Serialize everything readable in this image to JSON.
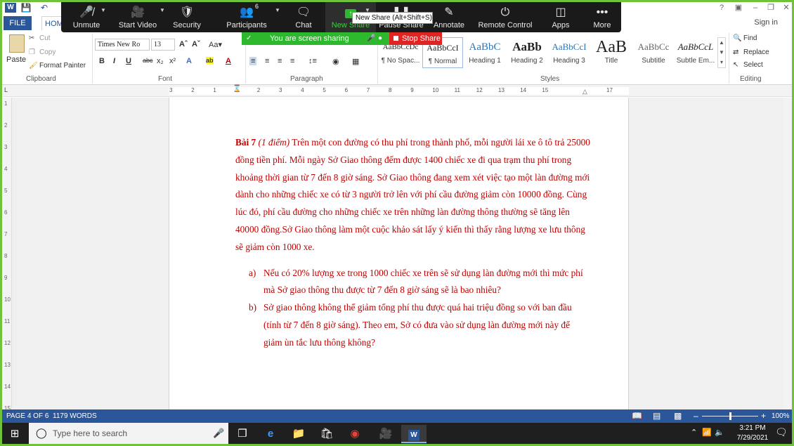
{
  "zoom_toolbar": {
    "unmute": "Unmute",
    "start_video": "Start Video",
    "security": "Security",
    "participants": "Participants",
    "participants_count": "6",
    "chat": "Chat",
    "new_share": "New Share",
    "pause_share": "Pause Share",
    "annotate": "Annotate",
    "remote_control": "Remote Control",
    "apps": "Apps",
    "more": "More",
    "tooltip": "New Share (Alt+Shift+S)",
    "sharing_status": "You are screen sharing",
    "stop_share": "Stop Share"
  },
  "word": {
    "tabs": {
      "file": "FILE",
      "home": "HOM"
    },
    "sign_in": "Sign in",
    "clipboard": {
      "paste": "Paste",
      "cut": "Cut",
      "copy": "Copy",
      "format_painter": "Format Painter",
      "label": "Clipboard"
    },
    "font": {
      "name": "Times New Ro",
      "size": "13",
      "label": "Font"
    },
    "paragraph": {
      "label": "Paragraph"
    },
    "styles": {
      "label": "Styles",
      "items": [
        {
          "sample": "AaBbCcDc",
          "name": "¶ No Spac..."
        },
        {
          "sample": "AaBbCcI",
          "name": "¶ Normal"
        },
        {
          "sample": "AaBbC",
          "name": "Heading 1"
        },
        {
          "sample": "AaBb",
          "name": "Heading 2"
        },
        {
          "sample": "AaBbCcI",
          "name": "Heading 3"
        },
        {
          "sample": "AaB",
          "name": "Title"
        },
        {
          "sample": "AaBbCc",
          "name": "Subtitle"
        },
        {
          "sample": "AaBbCcL",
          "name": "Subtle Em..."
        }
      ]
    },
    "editing": {
      "find": "Find",
      "replace": "Replace",
      "select": "Select",
      "label": "Editing"
    },
    "ruler_numbers": [
      "3",
      "2",
      "1",
      "1",
      "2",
      "3",
      "4",
      "5",
      "6",
      "7",
      "8",
      "9",
      "10",
      "11",
      "12",
      "13",
      "14",
      "15",
      "17"
    ],
    "vruler_numbers": [
      "1",
      "2",
      "3",
      "4",
      "5",
      "6",
      "7",
      "8",
      "9",
      "10",
      "11",
      "12",
      "13",
      "14",
      "15"
    ],
    "document": {
      "para_bold": "Bài 7",
      "para_italic": "(1 điểm)",
      "para_text": " Trên một con đường có thu phí trong thành phố, mỗi người lái xe ô tô trả 25000 đồng tiền phí. Mỗi ngày Sở Giao thông đếm được 1400 chiếc xe đi qua trạm thu phí trong khoảng thời gian từ 7 đến 8 giờ sáng. Sở Giao thông đang xem xét việc tạo một làn đường mới dành cho những chiếc xe có từ 3 người trở lên với phí cầu đường giảm còn 10000 đồng. Cùng lúc đó, phí cầu đường cho những chiếc xe trên những làn đường thông thường sẽ tăng lên 40000 đồng.Sở Giao thông làm một cuộc khảo sát lấy ý kiến thì thấy rằng lượng xe lưu thông sẽ giảm còn 1000 xe.",
      "items": [
        {
          "label": "a)",
          "text": "Nếu có 20% lượng xe trong 1000 chiếc xe trên sẽ sử dụng làn đường mới thì mức phí mà Sở giao thông thu được từ 7 đến 8 giờ sáng sẽ là bao nhiêu?"
        },
        {
          "label": "b)",
          "text": "Sở giao thông không thể giảm tổng phí thu được quá hai triệu đồng so với ban đầu (tính từ 7 đến 8 giờ sáng). Theo em, Sở có đưa vào sử dụng làn đường mới này để giảm ùn tắc lưu thông không?"
        }
      ]
    },
    "status": {
      "page": "PAGE 4 OF 6",
      "words": "1179 WORDS",
      "zoom": "100%",
      "zoom_level": 100
    }
  },
  "taskbar": {
    "search_placeholder": "Type here to search",
    "time": "3:21 PM",
    "date": "7/29/2021"
  },
  "colors": {
    "zoom_bg": "#1a1a1a",
    "share_green": "#2eb82e",
    "stop_red": "#e02424",
    "word_blue": "#2b579a",
    "doc_text": "#c00000",
    "outer_green": "#6fc33b"
  }
}
